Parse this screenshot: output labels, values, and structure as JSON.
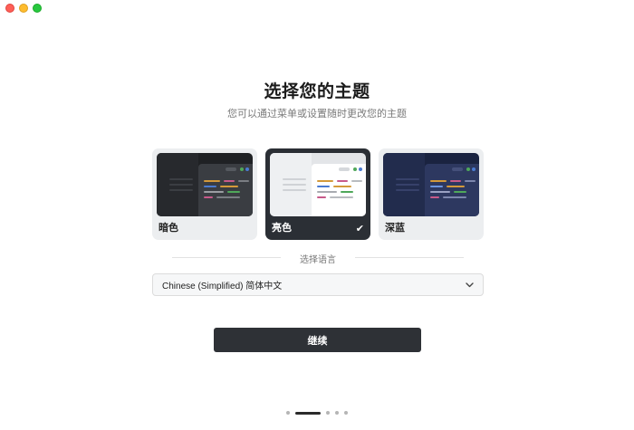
{
  "window": {
    "controls": [
      "close",
      "minimize",
      "maximize"
    ]
  },
  "header": {
    "title": "选择您的主题",
    "subtitle": "您可以通过菜单或设置随时更改您的主题"
  },
  "themes": [
    {
      "label": "暗色",
      "selected": false
    },
    {
      "label": "亮色",
      "selected": true,
      "check_icon": "✔"
    },
    {
      "label": "深蓝",
      "selected": false
    }
  ],
  "language": {
    "section_label": "选择语言",
    "selected": "Chinese (Simplified) 简体中文",
    "chevron_icon": "⌄"
  },
  "actions": {
    "continue_label": "继续"
  },
  "pager": {
    "total": 5,
    "current": 2
  },
  "colors": {
    "accent_dark": "#2e3136",
    "close": "#fe5f57",
    "minimize": "#febc2e",
    "maximize": "#28c840"
  }
}
